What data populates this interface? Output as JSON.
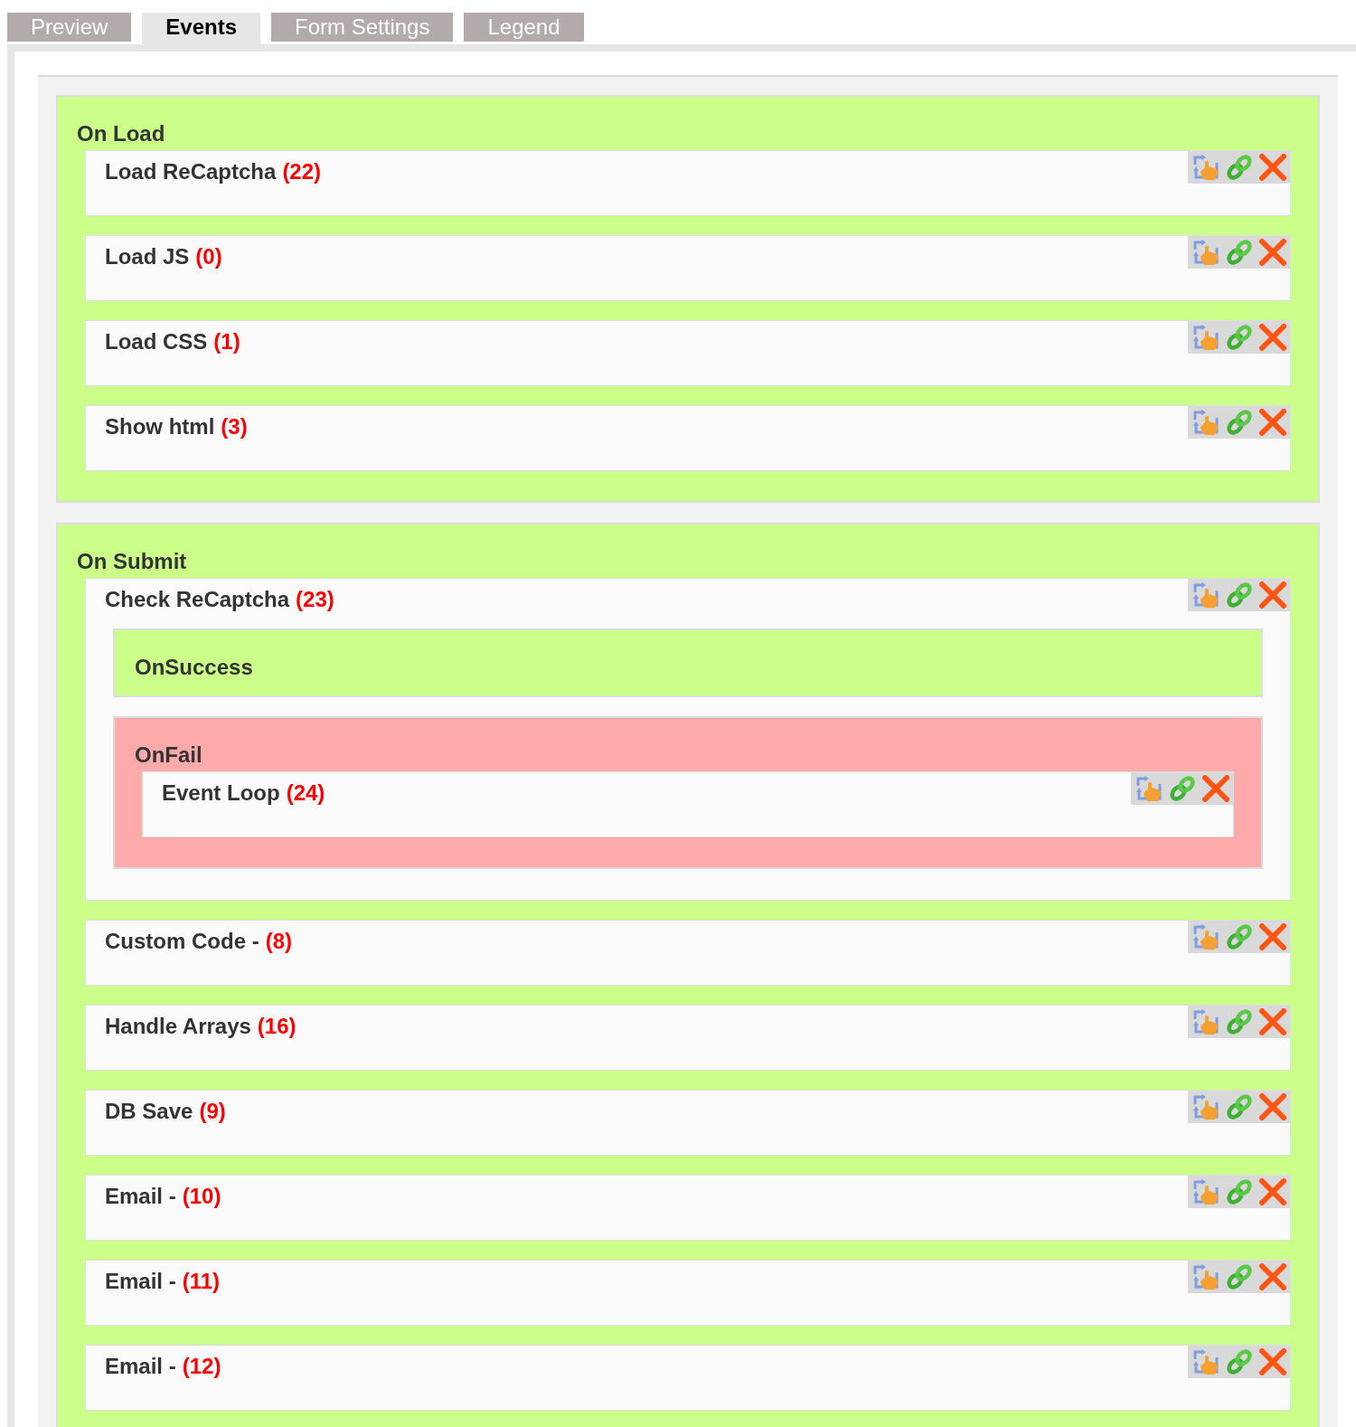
{
  "tabs": [
    {
      "label": "Preview",
      "selected": false
    },
    {
      "label": "Events",
      "selected": true
    },
    {
      "label": "Form Settings",
      "selected": false
    },
    {
      "label": "Legend",
      "selected": false
    }
  ],
  "sections": [
    {
      "title": "On Load",
      "actions": [
        {
          "name": "Load ReCaptcha",
          "count": "(22)"
        },
        {
          "name": "Load JS",
          "count": "(0)"
        },
        {
          "name": "Load CSS",
          "count": "(1)"
        },
        {
          "name": "Show html",
          "count": "(3)"
        }
      ]
    },
    {
      "title": "On Submit",
      "actions": [
        {
          "name": "Check ReCaptcha",
          "count": "(23)",
          "branches": [
            {
              "title": "OnSuccess",
              "kind": "success"
            },
            {
              "title": "OnFail",
              "kind": "fail",
              "actions": [
                {
                  "name": "Event Loop",
                  "count": "(24)"
                }
              ]
            }
          ]
        },
        {
          "name": "Custom Code -",
          "count": "(8)"
        },
        {
          "name": "Handle Arrays",
          "count": "(16)"
        },
        {
          "name": "DB Save",
          "count": "(9)"
        },
        {
          "name": "Email -",
          "count": "(10)"
        },
        {
          "name": "Email -",
          "count": "(11)"
        },
        {
          "name": "Email -",
          "count": "(12)"
        }
      ]
    }
  ]
}
